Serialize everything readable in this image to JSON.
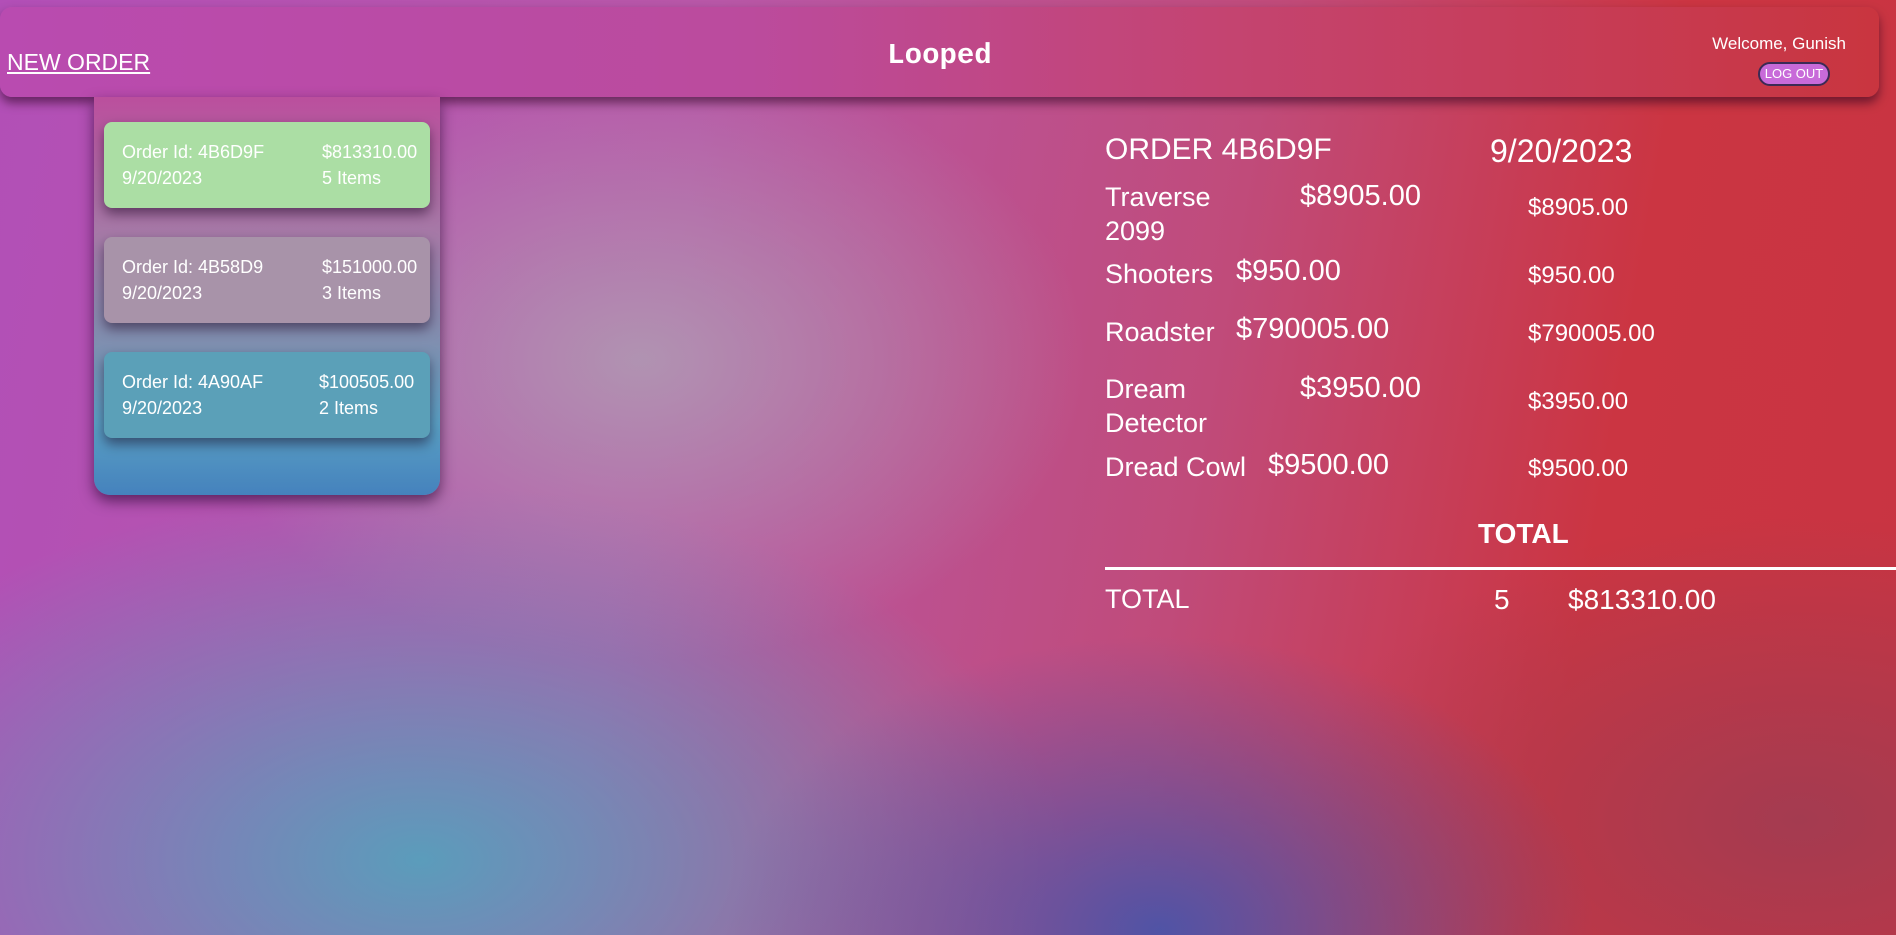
{
  "header": {
    "new_order_label": "NEW ORDER",
    "app_title": "Looped",
    "welcome_text": "Welcome, Gunish",
    "logout_label": "LOG OUT"
  },
  "orders": [
    {
      "id_text": "Order Id: 4B6D9F",
      "amount": "$813310.00",
      "date": "9/20/2023",
      "items": "5 Items",
      "color": "#abdea4"
    },
    {
      "id_text": "Order Id: 4B58D9",
      "amount": "$151000.00",
      "date": "9/20/2023",
      "items": "3 Items",
      "color": "#a893a9"
    },
    {
      "id_text": "Order Id: 4A90AF",
      "amount": "$100505.00",
      "date": "9/20/2023",
      "items": "2 Items",
      "color": "#5ba0b8"
    }
  ],
  "detail": {
    "title": "ORDER 4B6D9F",
    "date": "9/20/2023",
    "items": [
      {
        "name": "Traverse 2099",
        "price": "$8905.00",
        "total": "$8905.00"
      },
      {
        "name": "Shooters",
        "price": "$950.00",
        "total": "$950.00"
      },
      {
        "name": "Roadster",
        "price": "$790005.00",
        "total": "$790005.00"
      },
      {
        "name": "Dream Detector",
        "price": "$3950.00",
        "total": "$3950.00"
      },
      {
        "name": "Dread Cowl",
        "price": "$9500.00",
        "total": "$9500.00"
      }
    ],
    "total_heading": "TOTAL",
    "total_label": "TOTAL",
    "total_count": "5",
    "total_amount": "$813310.00"
  }
}
